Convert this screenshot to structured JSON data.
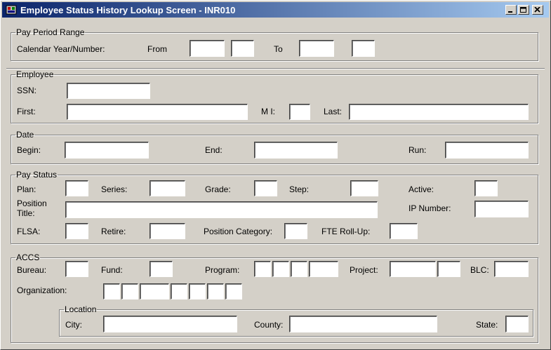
{
  "window": {
    "title": "Employee Status History Lookup Screen - INR010"
  },
  "pay_period": {
    "legend": "Pay Period Range",
    "calendar_label": "Calendar Year/Number:",
    "from_label": "From",
    "to_label": "To",
    "from_year": "",
    "from_number": "",
    "to_year": "",
    "to_number": ""
  },
  "employee": {
    "legend": "Employee",
    "ssn_label": "SSN:",
    "first_label": "First:",
    "mi_label": "M I:",
    "last_label": "Last:"
  },
  "date": {
    "legend": "Date",
    "begin_label": "Begin:",
    "end_label": "End:",
    "run_label": "Run:"
  },
  "pay_status": {
    "legend": "Pay Status",
    "plan_label": "Plan:",
    "series_label": "Series:",
    "grade_label": "Grade:",
    "step_label": "Step:",
    "active_label": "Active:",
    "position_label_1": "Position",
    "position_label_2": "Title:",
    "ip_number_label": "IP Number:",
    "flsa_label": "FLSA:",
    "retire_label": "Retire:",
    "position_category_label": "Position Category:",
    "fte_rollup_label": "FTE Roll-Up:"
  },
  "accs": {
    "legend": "ACCS",
    "bureau_label": "Bureau:",
    "fund_label": "Fund:",
    "program_label": "Program:",
    "project_label": "Project:",
    "blc_label": "BLC:",
    "organization_label": "Organization:",
    "location": {
      "legend": "Location",
      "city_label": "City:",
      "county_label": "County:",
      "state_label": "State:"
    }
  },
  "colors": {
    "title_start": "#0a246a",
    "title_end": "#a6caf0",
    "face": "#d4d0c8"
  },
  "icons": {
    "app": "app-icon",
    "minimize": "minimize-icon",
    "maximize": "maximize-icon",
    "close": "close-icon"
  }
}
